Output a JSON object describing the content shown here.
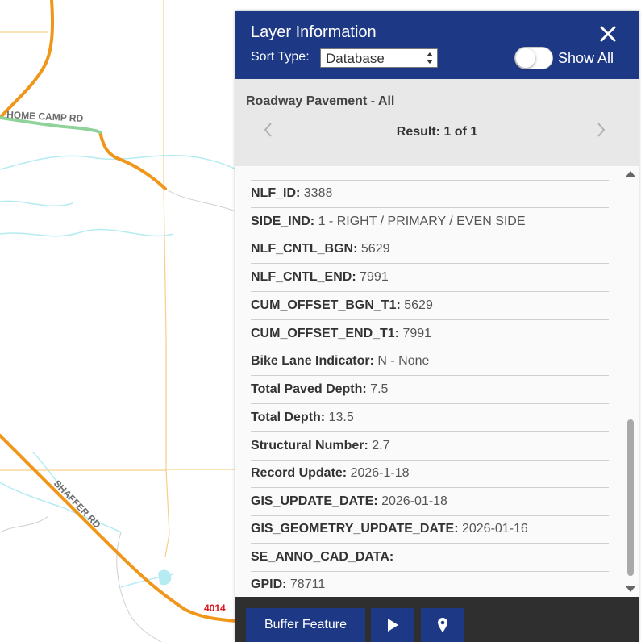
{
  "map": {
    "road_labels": [
      "HOME CAMP RD",
      "SHAFFER RD"
    ],
    "route_shield": "4014",
    "colors": {
      "major_road": "#f0961a",
      "minor_road": "#f4d08a",
      "water": "#b5ecf2",
      "highlight": "#8fd39b"
    }
  },
  "panel": {
    "title": "Layer Information",
    "sort_label": "Sort Type:",
    "sort_value": "Database",
    "toggle_label": "Show All",
    "toggle_on": false,
    "layer_name": "Roadway Pavement - All",
    "result_text": "Result: 1 of 1",
    "attributes": [
      {
        "key": "NLF_ID:",
        "value": "3388"
      },
      {
        "key": "SIDE_IND:",
        "value": "1 - RIGHT / PRIMARY / EVEN SIDE"
      },
      {
        "key": "NLF_CNTL_BGN:",
        "value": "5629"
      },
      {
        "key": "NLF_CNTL_END:",
        "value": "7991"
      },
      {
        "key": "CUM_OFFSET_BGN_T1:",
        "value": "5629"
      },
      {
        "key": "CUM_OFFSET_END_T1:",
        "value": "7991"
      },
      {
        "key": "Bike Lane Indicator:",
        "value": "N - None"
      },
      {
        "key": "Total Paved Depth:",
        "value": "7.5"
      },
      {
        "key": "Total Depth:",
        "value": "13.5"
      },
      {
        "key": "Structural Number:",
        "value": "2.7"
      },
      {
        "key": "Record Update:",
        "value": "2026-1-18"
      },
      {
        "key": "GIS_UPDATE_DATE:",
        "value": "2026-01-18"
      },
      {
        "key": "GIS_GEOMETRY_UPDATE_DATE:",
        "value": "2026-01-16"
      },
      {
        "key": "SE_ANNO_CAD_DATA:",
        "value": ""
      },
      {
        "key": "GPID:",
        "value": "78711"
      }
    ],
    "buttons": {
      "buffer_label": "Buffer Feature",
      "play_icon": "play-icon",
      "pin_icon": "map-pin-icon"
    },
    "colors": {
      "header": "#1d3885",
      "footer": "#2f2f2f"
    }
  }
}
